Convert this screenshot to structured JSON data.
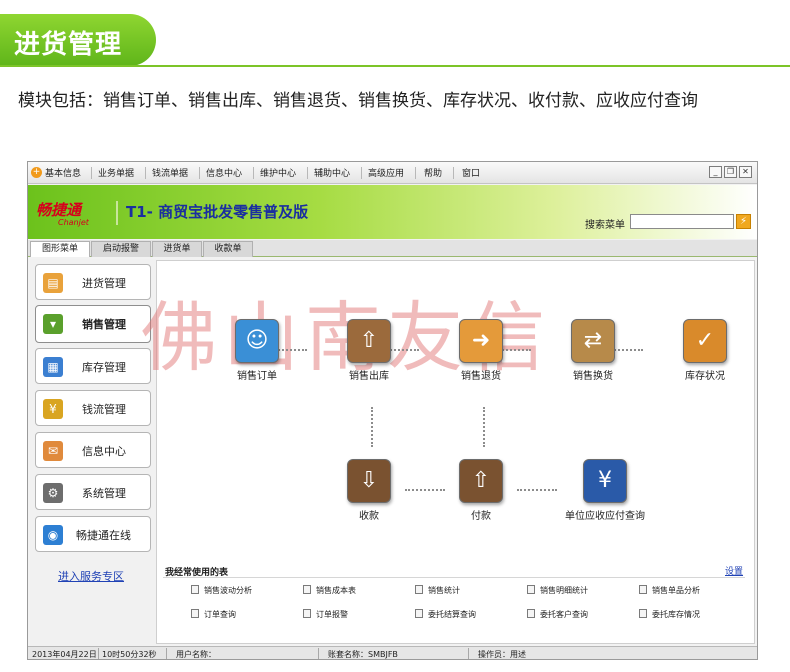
{
  "header": {
    "title": "进货管理",
    "description": "模块包括：销售订单、销售出库、销售退货、销售换货、库存状况、收付款、应收应付查询"
  },
  "menu": {
    "items": [
      "基本信息",
      "业务单据",
      "钱流单据",
      "信息中心",
      "维护中心",
      "辅助中心",
      "高级应用",
      "帮助",
      "窗口"
    ],
    "window_buttons": [
      "_",
      "❐",
      "✕"
    ]
  },
  "banner": {
    "logo": "畅捷通",
    "logo_sub": "Chanjet",
    "product_title": "T1- 商贸宝批发零售普及版",
    "search_label": "搜索菜单",
    "search_value": "",
    "search_button_icon": "lightning-icon"
  },
  "tabs": [
    "图形菜单",
    "启动报警",
    "进货单",
    "收款单"
  ],
  "sidebar": {
    "items": [
      {
        "label": "进货管理",
        "icon": "basket-icon",
        "color": "#e9a23b"
      },
      {
        "label": "销售管理",
        "icon": "cart-icon",
        "color": "#5aa02c"
      },
      {
        "label": "库存管理",
        "icon": "grid-icon",
        "color": "#3b7fd1"
      },
      {
        "label": "钱流管理",
        "icon": "money-icon",
        "color": "#d9a521"
      },
      {
        "label": "信息中心",
        "icon": "envelope-icon",
        "color": "#e08a3c"
      },
      {
        "label": "系统管理",
        "icon": "settings-icon",
        "color": "#6d6d6d"
      },
      {
        "label": "畅捷通在线",
        "icon": "globe-icon",
        "color": "#2d7fd3"
      }
    ],
    "service_link": "进入服务专区"
  },
  "flow": {
    "watermark": "佛山南友信",
    "nodes": [
      {
        "label": "销售订单",
        "icon": "customer-order-icon",
        "color": "#3a8fd6"
      },
      {
        "label": "销售出库",
        "icon": "box-up-arrow-icon",
        "color": "#9b6a3c"
      },
      {
        "label": "销售退货",
        "icon": "hand-return-icon",
        "color": "#e49a3a"
      },
      {
        "label": "销售换货",
        "icon": "hand-exchange-icon",
        "color": "#b78a4a"
      },
      {
        "label": "库存状况",
        "icon": "clipboard-icon",
        "color": "#d98a2b"
      },
      {
        "label": "收款",
        "icon": "drawer-in-icon",
        "color": "#7a5230"
      },
      {
        "label": "付款",
        "icon": "drawer-out-icon",
        "color": "#7a5230"
      },
      {
        "label": "单位应收应付查询",
        "icon": "yen-search-icon",
        "color": "#2a5aa8"
      }
    ]
  },
  "quick": {
    "title": "我经常使用的表",
    "settings": "设置",
    "rows": [
      [
        "销售波动分析",
        "销售成本表",
        "销售统计",
        "销售明细统计",
        "销售单品分析"
      ],
      [
        "订单查询",
        "订单报警",
        "委托结算查询",
        "委托客户查询",
        "委托库存情况"
      ]
    ]
  },
  "status": {
    "date": "2013年04月22日",
    "time": "10时50分32秒",
    "user_label": "用户名称：",
    "account_label": "账套名称：SMBJFB",
    "operator_label": "操作员：用述"
  }
}
